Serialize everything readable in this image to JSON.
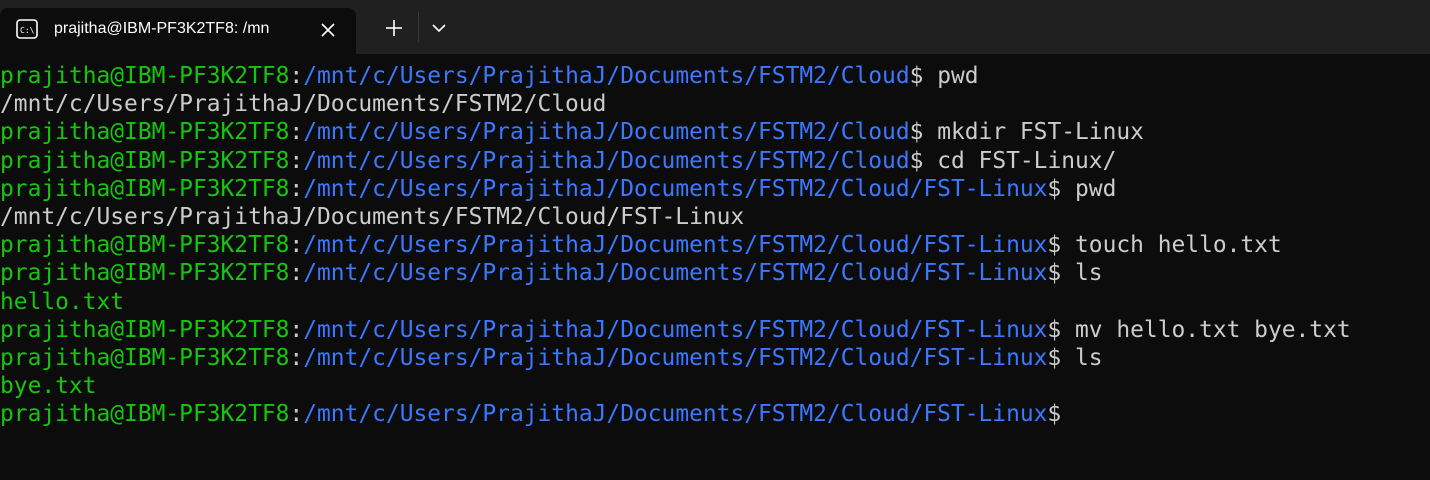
{
  "window": {
    "tab_title": "prajitha@IBM-PF3K2TF8: /mn",
    "icons": {
      "tab": "terminal-icon",
      "close": "close-icon",
      "new_tab": "plus-icon",
      "dropdown": "chevron-down-icon"
    }
  },
  "colors": {
    "background": "#0c0c0c",
    "titlebar": "#202020",
    "user": "#16c60c",
    "path": "#3b78ff",
    "text": "#cccccc"
  },
  "terminal": {
    "lines": [
      {
        "type": "prompt",
        "user": "prajitha@IBM-PF3K2TF8",
        "sep": ":",
        "path": "/mnt/c/Users/PrajithaJ/Documents/FSTM2/Cloud",
        "end": "$ ",
        "cmd": "pwd"
      },
      {
        "type": "output",
        "text": "/mnt/c/Users/PrajithaJ/Documents/FSTM2/Cloud",
        "color": "plain"
      },
      {
        "type": "prompt",
        "user": "prajitha@IBM-PF3K2TF8",
        "sep": ":",
        "path": "/mnt/c/Users/PrajithaJ/Documents/FSTM2/Cloud",
        "end": "$ ",
        "cmd": "mkdir FST-Linux"
      },
      {
        "type": "prompt",
        "user": "prajitha@IBM-PF3K2TF8",
        "sep": ":",
        "path": "/mnt/c/Users/PrajithaJ/Documents/FSTM2/Cloud",
        "end": "$ ",
        "cmd": "cd FST-Linux/"
      },
      {
        "type": "prompt",
        "user": "prajitha@IBM-PF3K2TF8",
        "sep": ":",
        "path": "/mnt/c/Users/PrajithaJ/Documents/FSTM2/Cloud/FST-Linux",
        "end": "$ ",
        "cmd": "pwd"
      },
      {
        "type": "output",
        "text": "/mnt/c/Users/PrajithaJ/Documents/FSTM2/Cloud/FST-Linux",
        "color": "plain"
      },
      {
        "type": "prompt",
        "user": "prajitha@IBM-PF3K2TF8",
        "sep": ":",
        "path": "/mnt/c/Users/PrajithaJ/Documents/FSTM2/Cloud/FST-Linux",
        "end": "$ ",
        "cmd": "touch hello.txt"
      },
      {
        "type": "prompt",
        "user": "prajitha@IBM-PF3K2TF8",
        "sep": ":",
        "path": "/mnt/c/Users/PrajithaJ/Documents/FSTM2/Cloud/FST-Linux",
        "end": "$ ",
        "cmd": "ls"
      },
      {
        "type": "output",
        "text": "hello.txt",
        "color": "green"
      },
      {
        "type": "prompt",
        "user": "prajitha@IBM-PF3K2TF8",
        "sep": ":",
        "path": "/mnt/c/Users/PrajithaJ/Documents/FSTM2/Cloud/FST-Linux",
        "end": "$ ",
        "cmd": "mv hello.txt bye.txt"
      },
      {
        "type": "prompt",
        "user": "prajitha@IBM-PF3K2TF8",
        "sep": ":",
        "path": "/mnt/c/Users/PrajithaJ/Documents/FSTM2/Cloud/FST-Linux",
        "end": "$ ",
        "cmd": "ls"
      },
      {
        "type": "output",
        "text": "bye.txt",
        "color": "green"
      },
      {
        "type": "prompt",
        "user": "prajitha@IBM-PF3K2TF8",
        "sep": ":",
        "path": "/mnt/c/Users/PrajithaJ/Documents/FSTM2/Cloud/FST-Linux",
        "end": "$",
        "cmd": ""
      }
    ]
  }
}
